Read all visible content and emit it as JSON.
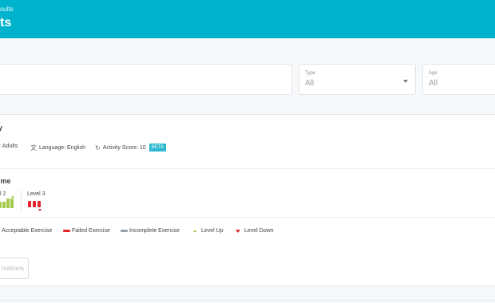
{
  "header": {
    "breadcrumb": "sults",
    "title": "ts"
  },
  "filters": {
    "search": {
      "value": ""
    },
    "type": {
      "label": "Type",
      "value": "All"
    },
    "age": {
      "label": "Age",
      "value": "All"
    }
  },
  "summary": {
    "title": "y",
    "audience": "Adults",
    "language_label": "Language: English",
    "activity_score_label": "Activity Score: 10",
    "beta_badge": "BETA"
  },
  "timeline": {
    "title": "ime",
    "levels": [
      {
        "label": "l 2",
        "bars": [
          "green",
          "green",
          "green",
          "green"
        ],
        "marker": "level-up"
      },
      {
        "label": "Level 3",
        "bars": [
          "red",
          "red",
          "red"
        ],
        "marker": "level-down"
      }
    ],
    "legend": {
      "acceptable": "Acceptable Exercise",
      "failed": "Failed Exercise",
      "incomplete": "Incomplete Exercise",
      "level_up": "Level Up",
      "level_down": "Level Down"
    }
  },
  "actions": {
    "observations_button": "rvations"
  },
  "colors": {
    "header": "#00b3cc",
    "acceptable": "#a3c94a",
    "failed": "#e3262c",
    "incomplete": "#9aa0a8",
    "beta": "#2db9d0"
  }
}
